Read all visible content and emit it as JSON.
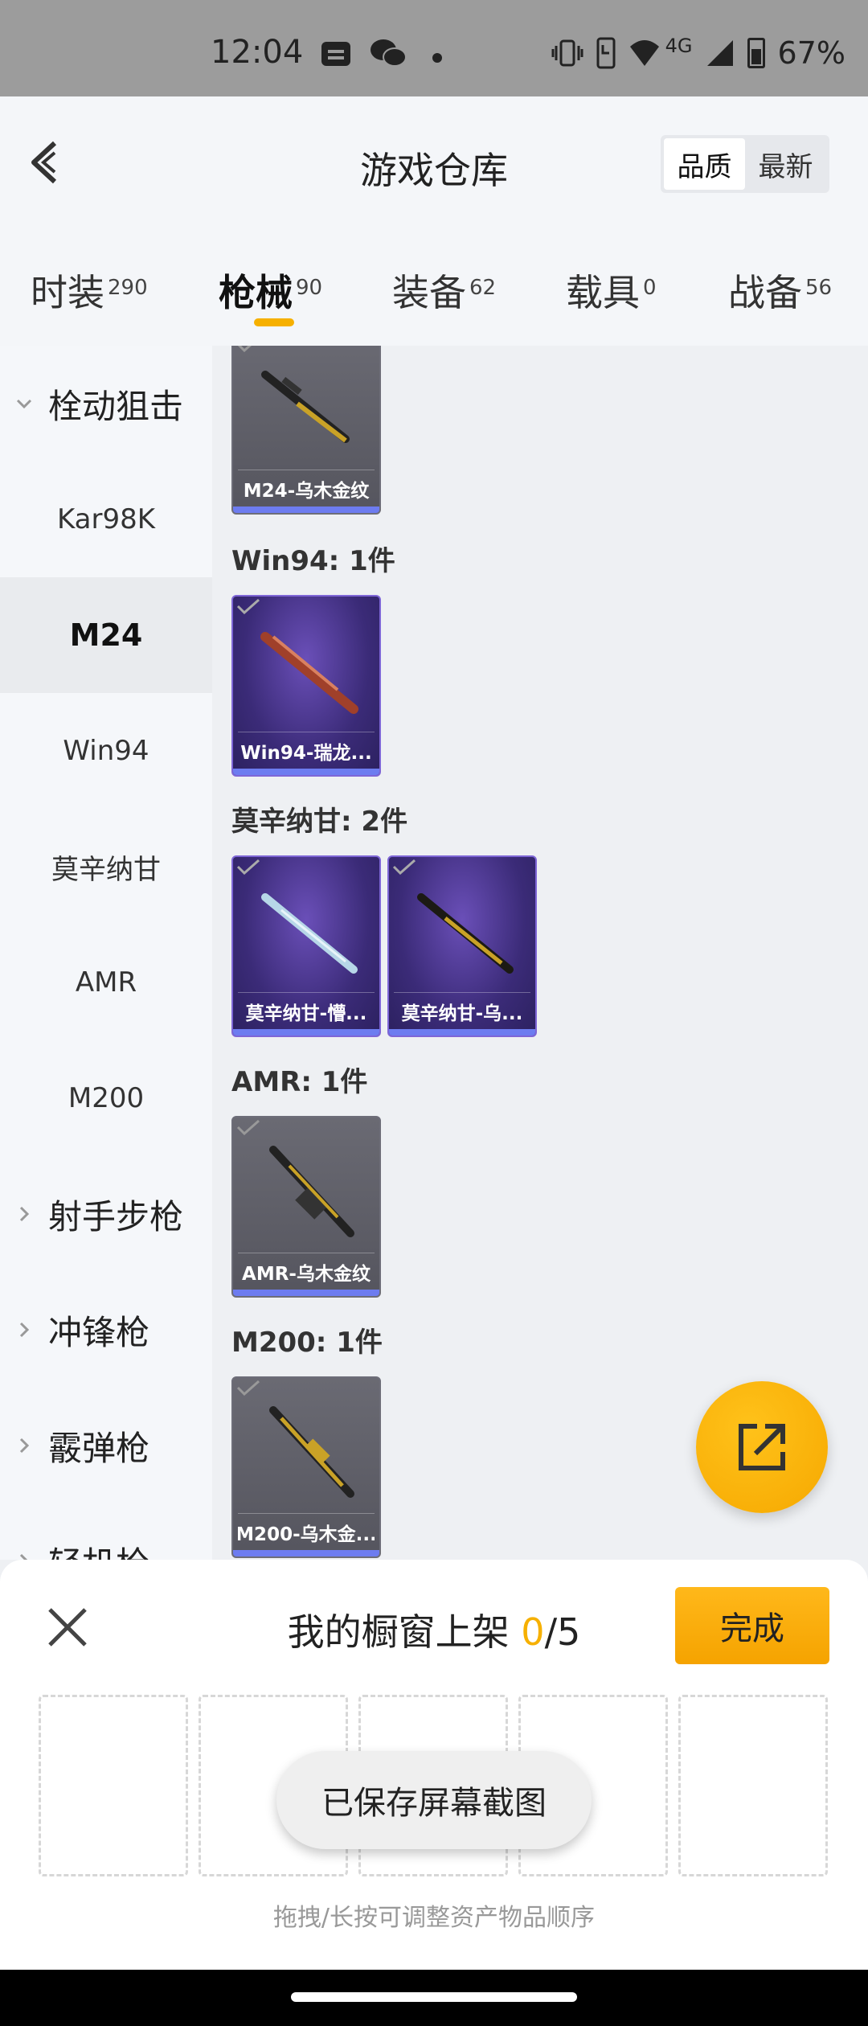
{
  "status_bar": {
    "time": "12:04",
    "network": "4G",
    "battery": "67%",
    "icons": [
      "message-icon",
      "wechat-icon",
      "dot-icon",
      "vibrate-icon",
      "nfc-icon",
      "wifi-icon",
      "signal-icon",
      "battery-icon"
    ]
  },
  "header": {
    "title": "游戏仓库",
    "sort_options": [
      "品质",
      "最新"
    ],
    "active_sort": "品质"
  },
  "tabs": [
    {
      "label": "时装",
      "count": "290"
    },
    {
      "label": "枪械",
      "count": "90",
      "active": true
    },
    {
      "label": "装备",
      "count": "62"
    },
    {
      "label": "载具",
      "count": "0"
    },
    {
      "label": "战备",
      "count": "56"
    }
  ],
  "sidebar": {
    "group_open": "栓动狙击",
    "items": [
      "Kar98K",
      "M24",
      "Win94",
      "莫辛纳甘",
      "AMR",
      "M200"
    ],
    "active_item": "M24",
    "groups_closed": [
      "射手步枪",
      "冲锋枪",
      "霰弹枪",
      "轻机枪"
    ]
  },
  "sections": [
    {
      "title": "",
      "items": [
        {
          "caption": "M24-乌木金纹",
          "style": "gray"
        }
      ]
    },
    {
      "title": "Win94: 1件",
      "items": [
        {
          "caption": "Win94-瑞龙...",
          "style": "purple"
        }
      ]
    },
    {
      "title": "莫辛纳甘: 2件",
      "items": [
        {
          "caption": "莫辛纳甘-懵...",
          "style": "purple"
        },
        {
          "caption": "莫辛纳甘-乌...",
          "style": "purple"
        }
      ]
    },
    {
      "title": "AMR: 1件",
      "items": [
        {
          "caption": "AMR-乌木金纹",
          "style": "gray"
        }
      ]
    },
    {
      "title": "M200: 1件",
      "items": [
        {
          "caption": "M200-乌木金...",
          "style": "gray"
        }
      ]
    }
  ],
  "sheet": {
    "title_prefix": "我的橱窗上架 ",
    "count": "0",
    "total": "/5",
    "done_label": "完成",
    "hint": "拖拽/长按可调整资产物品顺序"
  },
  "toast": "已保存屏幕截图",
  "colors": {
    "accent": "#f6b000",
    "purple_card": "#3b2b78",
    "gray_card": "#5e5e67",
    "quality_bar": "#6d7cf0"
  }
}
